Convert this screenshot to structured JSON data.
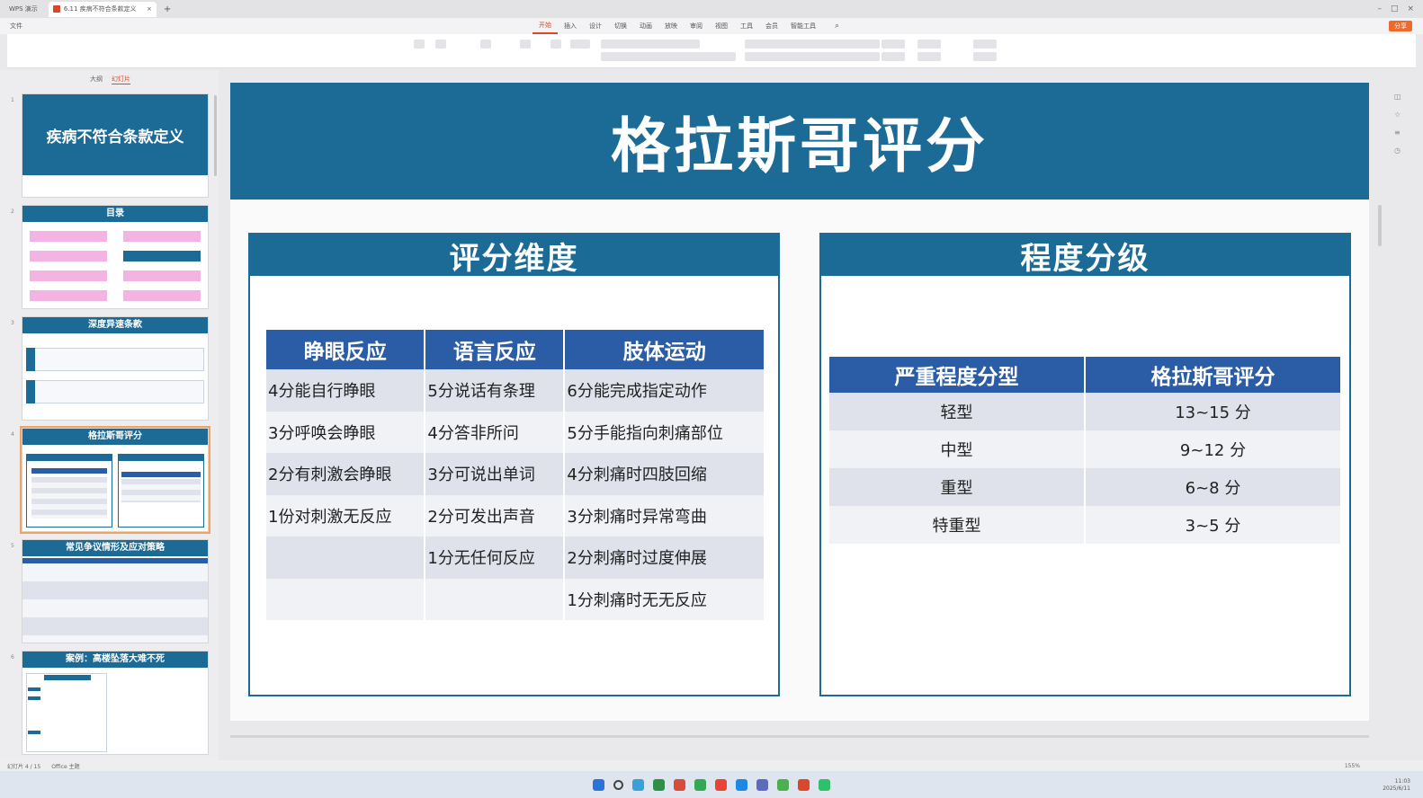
{
  "window": {
    "app_tab": "WPS 演示",
    "doc_tab": "6.11 疾病不符合条款定义"
  },
  "menu": {
    "file": "文件",
    "items": [
      "开始",
      "插入",
      "设计",
      "切换",
      "动画",
      "放映",
      "审阅",
      "视图",
      "工具",
      "会员",
      "智能工具"
    ],
    "share": "分享"
  },
  "left_pane": {
    "tabs": [
      "大纲",
      "幻灯片"
    ],
    "thumbnails": [
      {
        "num": "1",
        "title": "疾病不符合条款定义"
      },
      {
        "num": "2",
        "title": "目录"
      },
      {
        "num": "3",
        "title": "深度异速条款"
      },
      {
        "num": "4",
        "title": "格拉斯哥评分"
      },
      {
        "num": "5",
        "title": "常见争议情形及应对策略"
      },
      {
        "num": "6",
        "title": "案例：高楼坠落大难不死"
      }
    ]
  },
  "slide": {
    "title": "格拉斯哥评分",
    "left_panel": {
      "header": "评分维度",
      "columns": [
        "睁眼反应",
        "语言反应",
        "肢体运动"
      ],
      "rows": [
        [
          "4分能自行睁眼",
          "5分说话有条理",
          "6分能完成指定动作"
        ],
        [
          "3分呼唤会睁眼",
          "4分答非所问",
          "5分手能指向刺痛部位"
        ],
        [
          "2分有刺激会睁眼",
          "3分可说出单词",
          "4分刺痛时四肢回缩"
        ],
        [
          "1份对刺激无反应",
          "2分可发出声音",
          "3分刺痛时异常弯曲"
        ],
        [
          "",
          "1分无任何反应",
          "2分刺痛时过度伸展"
        ],
        [
          "",
          "",
          "1分刺痛时无无反应"
        ]
      ]
    },
    "right_panel": {
      "header": "程度分级",
      "columns": [
        "严重程度分型",
        "格拉斯哥评分"
      ],
      "rows": [
        [
          "轻型",
          "13~15 分"
        ],
        [
          "中型",
          "9~12 分"
        ],
        [
          "重型",
          "6~8 分"
        ],
        [
          "特重型",
          "3~5 分"
        ]
      ]
    }
  },
  "status": {
    "slide_pos": "幻灯片 4 / 15",
    "theme": "Office 主题",
    "zoom": "155%"
  },
  "clock": {
    "time": "11:03",
    "date": "2025/6/11"
  },
  "colors": {
    "title_band": "#1c6b97",
    "table_header": "#2b5ca6",
    "row_alt": "#dfe2ea",
    "accent": "#d9482b"
  }
}
